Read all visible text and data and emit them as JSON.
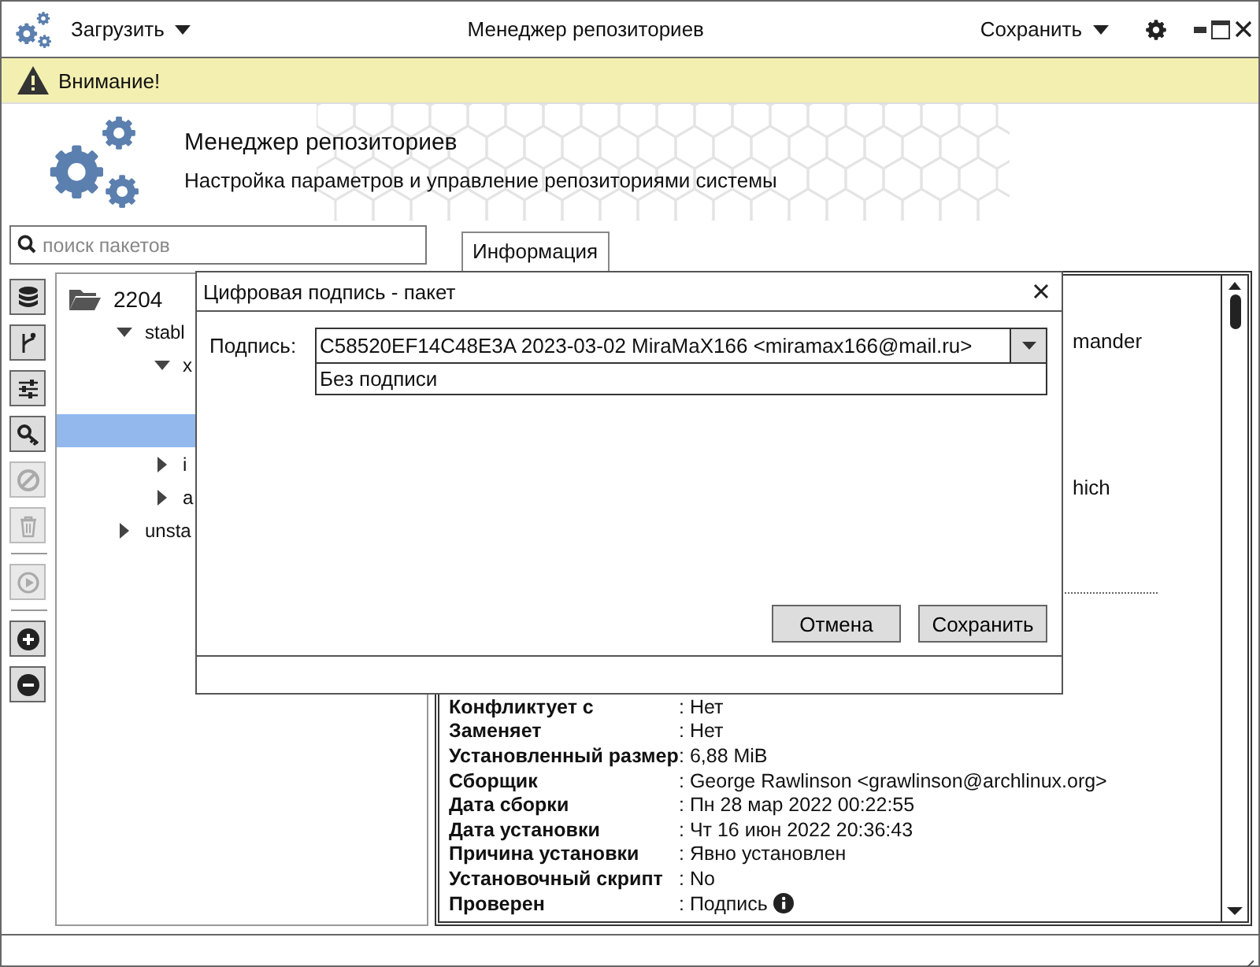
{
  "window": {
    "title": "Менеджер репозиториев",
    "menus": [
      {
        "label": "Загрузить"
      },
      {
        "label": "Сохранить"
      }
    ]
  },
  "warning": {
    "text": "Внимание!"
  },
  "header": {
    "title": "Менеджер репозиториев",
    "subtitle": "Настройка параметров и управление репозиториями системы"
  },
  "search": {
    "placeholder": "поиск пакетов"
  },
  "tabs": [
    {
      "label": "Информация",
      "selected": true
    }
  ],
  "toolbar": [
    {
      "kind": "database",
      "disabled": false
    },
    {
      "kind": "branch",
      "disabled": false
    },
    {
      "kind": "sliders",
      "disabled": false
    },
    {
      "kind": "key",
      "disabled": false
    },
    {
      "kind": "ban",
      "disabled": true
    },
    {
      "kind": "trash",
      "disabled": true
    },
    {
      "kind": "separator"
    },
    {
      "kind": "play",
      "disabled": true
    },
    {
      "kind": "separator"
    },
    {
      "kind": "plus",
      "disabled": false
    },
    {
      "kind": "minus",
      "disabled": false
    }
  ],
  "tree": [
    {
      "label": "2204",
      "children": [
        {
          "label": "stabl",
          "expanded": true,
          "children": [
            {
              "label": "x",
              "expanded": true,
              "children": [
                {
                  "selected": false
                },
                {
                  "selected": true
                }
              ]
            },
            {
              "label": "i",
              "expanded": false
            },
            {
              "label": "a",
              "expanded": false
            }
          ]
        },
        {
          "label": "unsta",
          "expanded": false
        }
      ]
    }
  ],
  "info": {
    "partial_rows": [
      {
        "value": "mander"
      },
      {
        "value": "hich"
      }
    ],
    "rows": [
      {
        "label": "Конфликтует с",
        "value": ": Нет",
        "info_icon": false
      },
      {
        "label": "Заменяет",
        "value": ": Нет",
        "info_icon": false
      },
      {
        "label": "Установленный размер",
        "value": ": 6,88 MiB",
        "info_icon": false
      },
      {
        "label": "Сборщик",
        "value": ": George Rawlinson <grawlinson@archlinux.org>",
        "info_icon": false
      },
      {
        "label": "Дата сборки",
        "value": ": Пн 28 мар 2022 00:22:55",
        "info_icon": false
      },
      {
        "label": "Дата установки",
        "value": ": Чт 16 июн 2022 20:36:43",
        "info_icon": false
      },
      {
        "label": "Причина установки",
        "value": ": Явно установлен",
        "info_icon": false
      },
      {
        "label": "Установочный скрипт",
        "value": ": No",
        "info_icon": false
      },
      {
        "label": "Проверен",
        "value": ": Подпись",
        "info_icon": true
      }
    ]
  },
  "dialog": {
    "title": "Цифровая подпись - пакет",
    "field_label": "Подпись:",
    "value": "C58520EF14C48E3A 2023-03-02 MiraMaX166 <miramax166@mail.ru>",
    "options": [
      "Без подписи"
    ],
    "buttons": [
      "Отмена",
      "Сохранить"
    ]
  }
}
